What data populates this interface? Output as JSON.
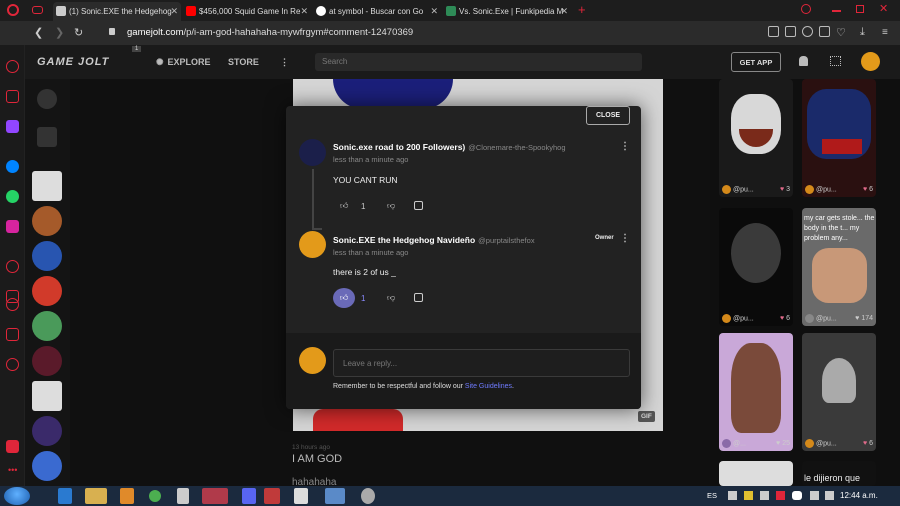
{
  "browser": {
    "tabs": [
      {
        "label": "(1) Sonic.EXE the Hedgehog",
        "active": true,
        "color": "#cccccc"
      },
      {
        "label": "$456,000 Squid Game In Re",
        "active": false,
        "color": "#ff0000"
      },
      {
        "label": "at symbol - Buscar con Go",
        "active": false,
        "color": "#4285f4"
      },
      {
        "label": "Vs. Sonic.Exe | Funkipedia M",
        "active": false,
        "color": "#2e8b57"
      }
    ],
    "new_tab": "+",
    "url_domain": "gamejolt.com",
    "url_path": "/p/i-am-god-hahahaha-mywfrgym#comment-12470369"
  },
  "gamejolt": {
    "logo": "GAME JOLT",
    "nav_explore": "EXPLORE",
    "nav_store": "STORE",
    "notification_count": "1",
    "search_placeholder": "Search",
    "get_app": "GET APP"
  },
  "modal": {
    "close": "CLOSE",
    "comments": [
      {
        "name": "Sonic.exe road to 200 Followers)",
        "handle": "@Clonemare-the-Spookyhog",
        "time": "less than a minute ago",
        "text": "YOU CANT RUN",
        "likes": "1"
      },
      {
        "name": "Sonic.EXE the Hedgehog Navideño",
        "handle": "@purptailsthefox",
        "badge": "Owner",
        "time": "less than a minute ago",
        "text": "there is 2 of us _",
        "likes": "1"
      }
    ],
    "reply_placeholder": "Leave a reply...",
    "reply_note": "Remember to be respectful and follow our",
    "reply_link": "Site Guidelines",
    "reply_period": "."
  },
  "post": {
    "gif_badge": "GIF",
    "time": "13 hours ago",
    "title": "I AM GOD",
    "body": "hahahaha"
  },
  "thumbs": [
    {
      "user": "@pu...",
      "likes": "3"
    },
    {
      "user": "@pu...",
      "likes": "6"
    },
    {
      "user": "@pu...",
      "likes": "6"
    },
    {
      "user": "@pu...",
      "likes": "174"
    },
    {
      "user": "@...",
      "likes": "25"
    },
    {
      "user": "@pu...",
      "likes": "6"
    }
  ],
  "thumb_text_cr": "my car gets stole... the body in the t... my problem any...",
  "thumb_text_bottom": "le dijieron que",
  "taskbar": {
    "language": "ES",
    "clock": "12:44 a.m."
  }
}
